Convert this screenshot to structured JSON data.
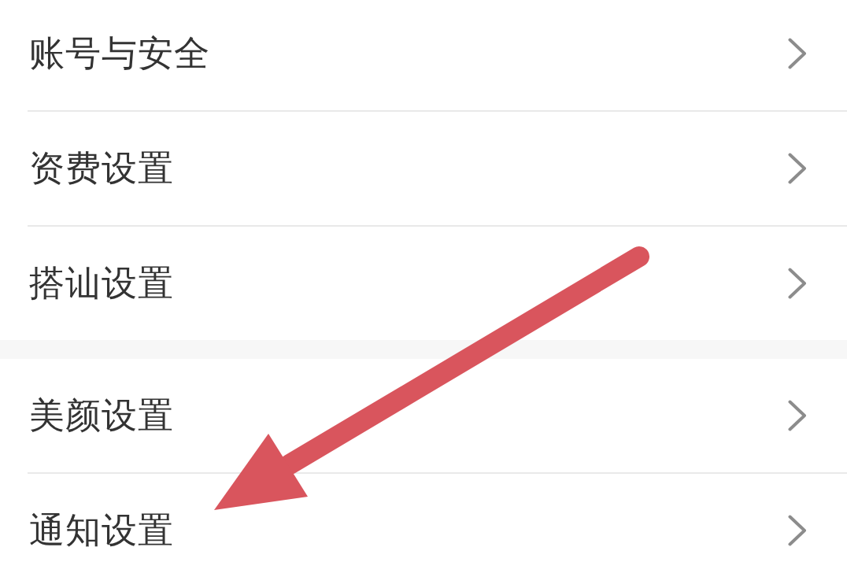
{
  "groups": [
    {
      "items": [
        {
          "label": "账号与安全"
        },
        {
          "label": "资费设置"
        },
        {
          "label": "搭讪设置"
        }
      ]
    },
    {
      "items": [
        {
          "label": "美颜设置"
        },
        {
          "label": "通知设置"
        }
      ]
    }
  ],
  "annotations": [
    {
      "kind": "arrow"
    }
  ]
}
